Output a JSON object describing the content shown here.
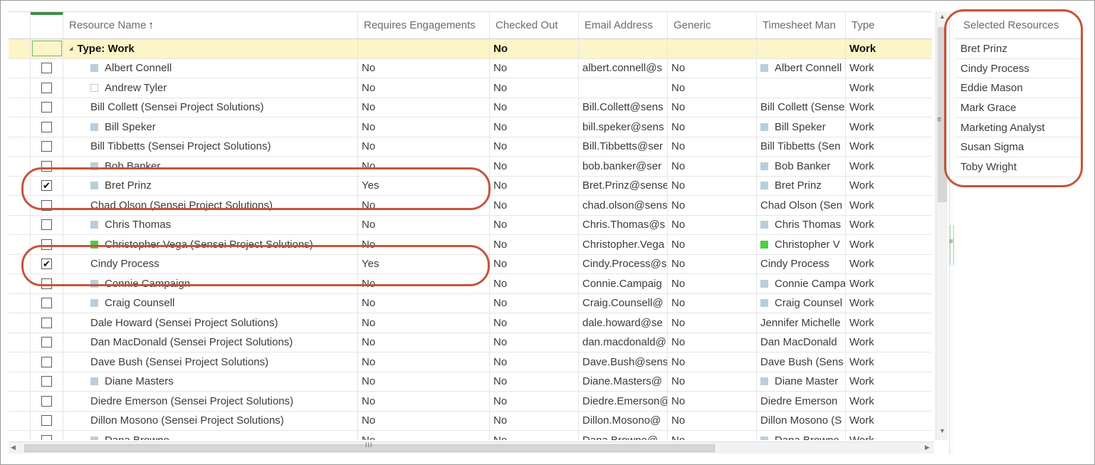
{
  "columns": {
    "name": "Resource Name",
    "sort_indicator": "↑",
    "requires": "Requires Engagements",
    "checked_out": "Checked Out",
    "email": "Email Address",
    "generic": "Generic",
    "timesheet": "Timesheet Man",
    "type": "Type"
  },
  "group": {
    "label": "Type: Work",
    "collapse_glyph": "◢",
    "checked_out": "No",
    "type": "Work"
  },
  "rows": [
    {
      "name": "Albert Connell",
      "icon": "blue-square",
      "requires": "No",
      "checked_out": "No",
      "email": "albert.connell@s",
      "generic": "No",
      "timesheet": "Albert Connell",
      "ts_icon": "blue-square",
      "type": "Work",
      "checked": false
    },
    {
      "name": "Andrew Tyler",
      "icon": "empty-square",
      "requires": "No",
      "checked_out": "No",
      "email": "",
      "generic": "No",
      "timesheet": "",
      "ts_icon": "",
      "type": "Work",
      "checked": false
    },
    {
      "name": "Bill Collett (Sensei Project Solutions)",
      "icon": "",
      "requires": "No",
      "checked_out": "No",
      "email": "Bill.Collett@sens",
      "generic": "No",
      "timesheet": "Bill Collett (Sense",
      "ts_icon": "",
      "type": "Work",
      "checked": false
    },
    {
      "name": "Bill Speker",
      "icon": "blue-square",
      "requires": "No",
      "checked_out": "No",
      "email": "bill.speker@sens",
      "generic": "No",
      "timesheet": "Bill Speker",
      "ts_icon": "blue-square",
      "type": "Work",
      "checked": false
    },
    {
      "name": "Bill Tibbetts (Sensei Project Solutions)",
      "icon": "",
      "requires": "No",
      "checked_out": "No",
      "email": "Bill.Tibbetts@ser",
      "generic": "No",
      "timesheet": "Bill Tibbetts (Sen",
      "ts_icon": "",
      "type": "Work",
      "checked": false
    },
    {
      "name": "Bob Banker",
      "icon": "blue-square",
      "requires": "No",
      "checked_out": "No",
      "email": "bob.banker@ser",
      "generic": "No",
      "timesheet": "Bob Banker",
      "ts_icon": "blue-square",
      "type": "Work",
      "checked": false
    },
    {
      "name": "Bret Prinz",
      "icon": "blue-square",
      "requires": "Yes",
      "checked_out": "No",
      "email": "Bret.Prinz@sense",
      "generic": "No",
      "timesheet": "Bret Prinz",
      "ts_icon": "blue-square",
      "type": "Work",
      "checked": true
    },
    {
      "name": "Chad Olson (Sensei Project Solutions)",
      "icon": "",
      "requires": "No",
      "checked_out": "No",
      "email": "chad.olson@sens",
      "generic": "No",
      "timesheet": "Chad Olson (Sen",
      "ts_icon": "",
      "type": "Work",
      "checked": false
    },
    {
      "name": "Chris Thomas",
      "icon": "blue-square",
      "requires": "No",
      "checked_out": "No",
      "email": "Chris.Thomas@s",
      "generic": "No",
      "timesheet": "Chris Thomas",
      "ts_icon": "blue-square",
      "type": "Work",
      "checked": false
    },
    {
      "name": "Christopher Vega (Sensei Project Solutions)",
      "icon": "green-square",
      "requires": "No",
      "checked_out": "No",
      "email": "Christopher.Vega",
      "generic": "No",
      "timesheet": "Christopher V",
      "ts_icon": "green-square",
      "type": "Work",
      "checked": false
    },
    {
      "name": "Cindy Process",
      "icon": "",
      "requires": "Yes",
      "checked_out": "No",
      "email": "Cindy.Process@s",
      "generic": "No",
      "timesheet": "Cindy Process",
      "ts_icon": "",
      "type": "Work",
      "checked": true
    },
    {
      "name": "Connie Campaign",
      "icon": "blue-square",
      "requires": "No",
      "checked_out": "No",
      "email": "Connie.Campaig",
      "generic": "No",
      "timesheet": "Connie Campa",
      "ts_icon": "blue-square",
      "type": "Work",
      "checked": false
    },
    {
      "name": "Craig Counsell",
      "icon": "blue-square",
      "requires": "No",
      "checked_out": "No",
      "email": "Craig.Counsell@",
      "generic": "No",
      "timesheet": "Craig Counsel",
      "ts_icon": "blue-square",
      "type": "Work",
      "checked": false
    },
    {
      "name": "Dale Howard (Sensei Project Solutions)",
      "icon": "",
      "requires": "No",
      "checked_out": "No",
      "email": "dale.howard@se",
      "generic": "No",
      "timesheet": "Jennifer Michelle",
      "ts_icon": "",
      "type": "Work",
      "checked": false
    },
    {
      "name": "Dan MacDonald (Sensei Project Solutions)",
      "icon": "",
      "requires": "No",
      "checked_out": "No",
      "email": "dan.macdonald@",
      "generic": "No",
      "timesheet": "Dan MacDonald",
      "ts_icon": "",
      "type": "Work",
      "checked": false
    },
    {
      "name": "Dave Bush (Sensei Project Solutions)",
      "icon": "",
      "requires": "No",
      "checked_out": "No",
      "email": "Dave.Bush@sens",
      "generic": "No",
      "timesheet": "Dave Bush (Sens",
      "ts_icon": "",
      "type": "Work",
      "checked": false
    },
    {
      "name": "Diane Masters",
      "icon": "blue-square",
      "requires": "No",
      "checked_out": "No",
      "email": "Diane.Masters@",
      "generic": "No",
      "timesheet": "Diane Master",
      "ts_icon": "blue-square",
      "type": "Work",
      "checked": false
    },
    {
      "name": "Diedre Emerson (Sensei Project Solutions)",
      "icon": "",
      "requires": "No",
      "checked_out": "No",
      "email": "Diedre.Emerson@",
      "generic": "No",
      "timesheet": "Diedre Emerson",
      "ts_icon": "",
      "type": "Work",
      "checked": false
    },
    {
      "name": "Dillon Mosono (Sensei Project Solutions)",
      "icon": "",
      "requires": "No",
      "checked_out": "No",
      "email": "Dillon.Mosono@",
      "generic": "No",
      "timesheet": "Dillon Mosono (S",
      "ts_icon": "",
      "type": "Work",
      "checked": false
    },
    {
      "name": "Dana Browne",
      "icon": "blue-square",
      "requires": "No",
      "checked_out": "No",
      "email": "Dana.Browne@",
      "generic": "No",
      "timesheet": "Dana Browne",
      "ts_icon": "blue-square",
      "type": "Work",
      "checked": false
    }
  ],
  "selected_panel": {
    "title": "Selected Resources",
    "items": [
      "Bret Prinz",
      "Cindy Process",
      "Eddie Mason",
      "Mark Grace",
      "Marketing Analyst",
      "Susan Sigma",
      "Toby Wright"
    ]
  },
  "scrollbars": {
    "up_glyph": "▲",
    "down_glyph": "▼",
    "left_glyph": "◀",
    "right_glyph": "▶",
    "h_grip": "III",
    "v_grip": "≡"
  },
  "colors": {
    "group_highlight": "#fcf5c7",
    "annotation": "#c4553b",
    "header_accent": "#3d8f47",
    "resource_icon": "#b8cfdb",
    "resource_icon_green": "#4ad042"
  }
}
